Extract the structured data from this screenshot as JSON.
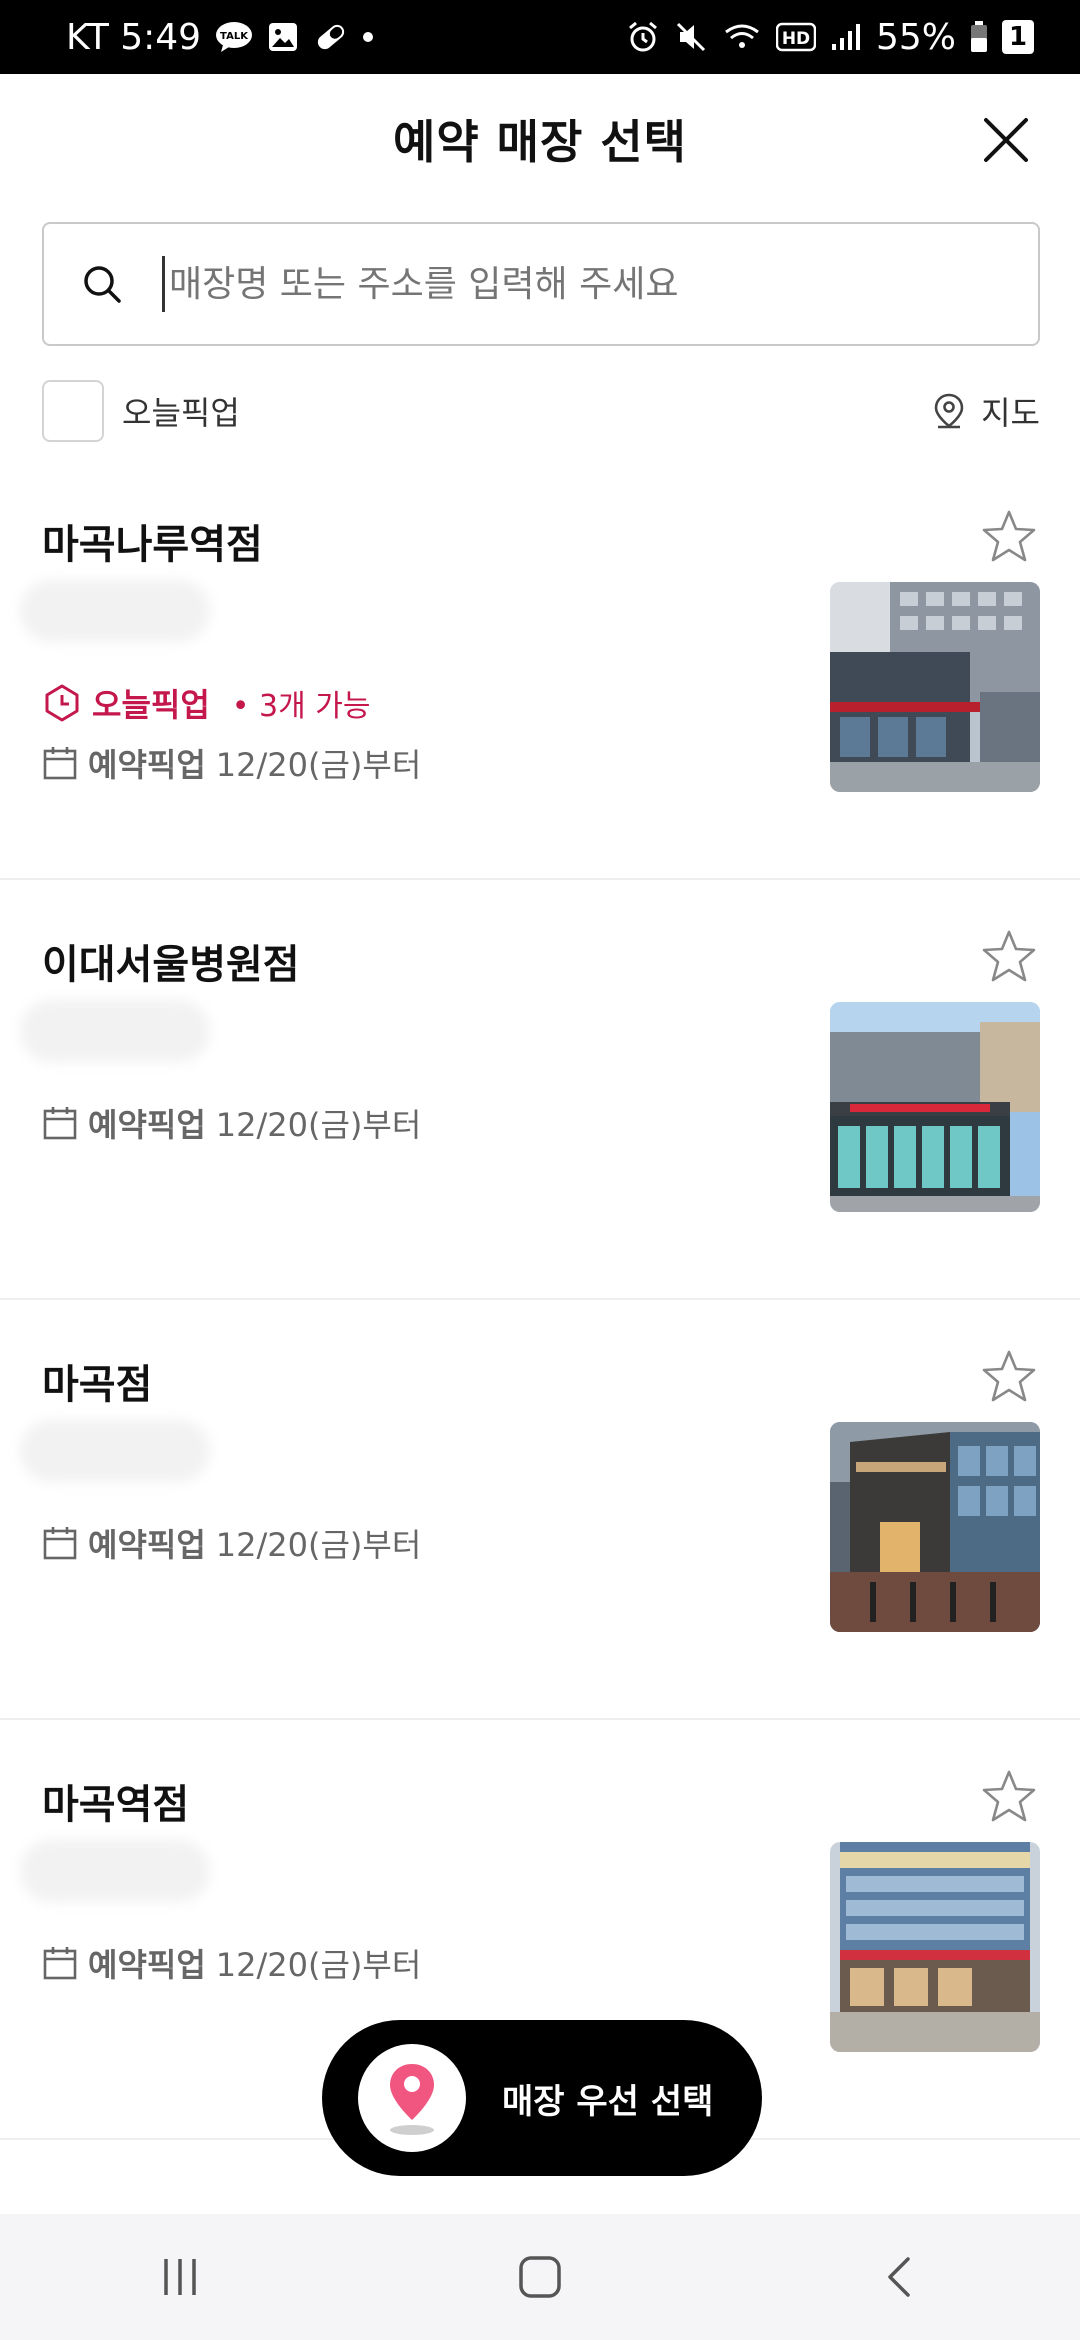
{
  "status_bar": {
    "carrier_time": "KT 5:49",
    "battery": "55%",
    "battery_extra": "1",
    "hd_label": "HD"
  },
  "header": {
    "title": "예약 매장 선택"
  },
  "search": {
    "placeholder": "매장명 또는 주소를 입력해 주세요"
  },
  "filter": {
    "today_pickup_label": "오늘픽업",
    "map_label": "지도"
  },
  "stores": [
    {
      "name": "마곡나루역점",
      "today_pickup": "오늘픽업",
      "today_pickup_avail": "• 3개 가능",
      "reserve_pickup": "예약픽업",
      "reserve_date": "12/20(금)부터"
    },
    {
      "name": "이대서울병원점",
      "reserve_pickup": "예약픽업",
      "reserve_date": "12/20(금)부터"
    },
    {
      "name": "마곡점",
      "reserve_pickup": "예약픽업",
      "reserve_date": "12/20(금)부터"
    },
    {
      "name": "마곡역점",
      "reserve_pickup": "예약픽업",
      "reserve_date": "12/20(금)부터"
    }
  ],
  "float_button": {
    "label": "매장 우선 선택"
  },
  "colors": {
    "accent": "#c4184d",
    "pin": "#f0567f"
  }
}
